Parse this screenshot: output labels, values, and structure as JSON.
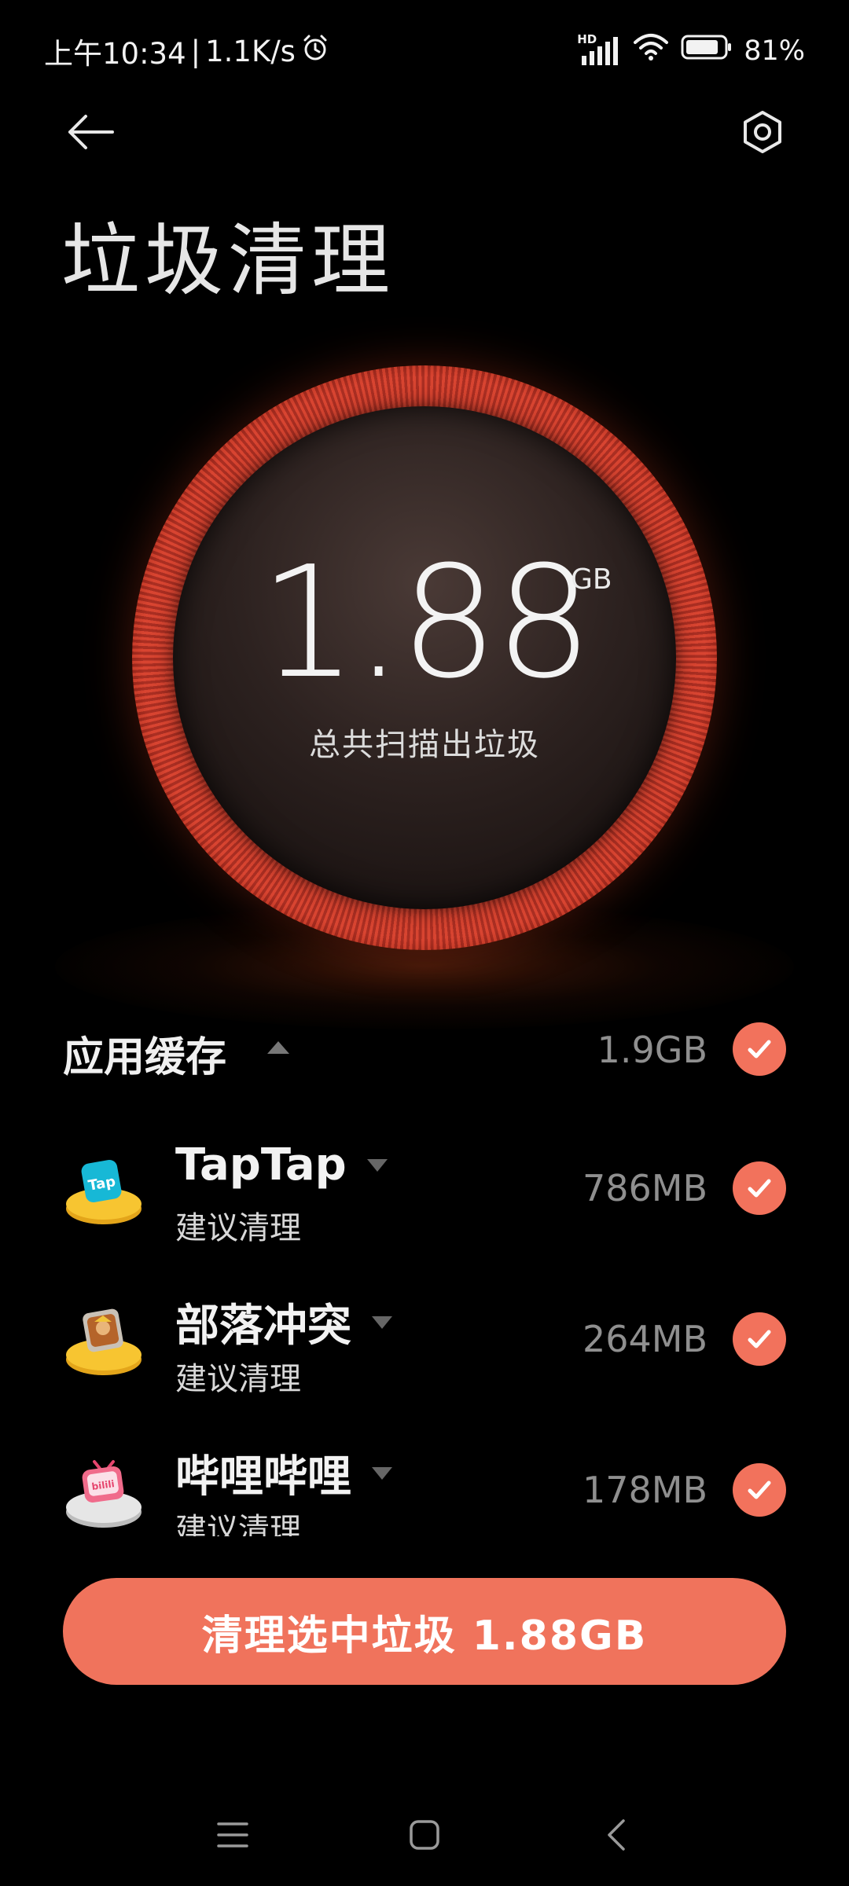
{
  "status_bar": {
    "time": "上午10:34",
    "separator": "|",
    "net_speed": "1.1K/s",
    "alarm_icon": "alarm-clock-icon",
    "network_type": "HD",
    "battery": "81%"
  },
  "header": {
    "back_icon": "back-arrow-icon",
    "settings_icon": "settings-hexagon-icon",
    "title": "垃圾清理"
  },
  "summary": {
    "value": "1.88",
    "unit": "GB",
    "caption": "总共扫描出垃圾"
  },
  "section": {
    "title": "应用缓存",
    "size": "1.9GB",
    "expanded": true,
    "checked": true
  },
  "apps": [
    {
      "name": "TapTap",
      "sub": "建议清理",
      "size": "786MB",
      "icon": "taptap-app-icon",
      "checked": true
    },
    {
      "name": "部落冲突",
      "sub": "建议清理",
      "size": "264MB",
      "icon": "clash-of-clans-app-icon",
      "checked": true
    },
    {
      "name": "哔哩哔哩",
      "sub": "建议清理",
      "size": "178MB",
      "icon": "bilibili-app-icon",
      "checked": true
    }
  ],
  "action": {
    "label": "清理选中垃圾 1.88GB"
  },
  "nav": {
    "menu_icon": "menu-lines-icon",
    "home_icon": "home-square-icon",
    "back_icon": "back-chevron-icon"
  },
  "colors": {
    "accent": "#f0735c",
    "background": "#000000",
    "ring": "#d1392a"
  }
}
